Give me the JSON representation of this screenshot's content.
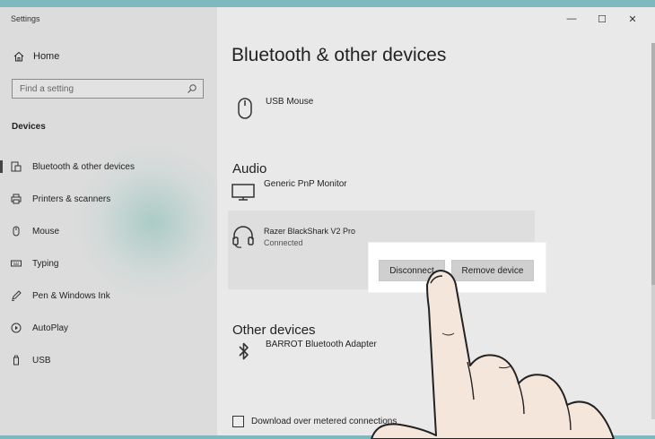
{
  "window": {
    "title": "Settings",
    "controls": {
      "minimize": "—",
      "maximize": "☐",
      "close": "✕"
    }
  },
  "sidebar": {
    "home_label": "Home",
    "search_placeholder": "Find a setting",
    "section_label": "Devices",
    "items": [
      {
        "label": "Bluetooth & other devices",
        "icon": "bluetooth-devices-icon",
        "active": true
      },
      {
        "label": "Printers & scanners",
        "icon": "printer-icon",
        "active": false
      },
      {
        "label": "Mouse",
        "icon": "mouse-icon",
        "active": false
      },
      {
        "label": "Typing",
        "icon": "keyboard-icon",
        "active": false
      },
      {
        "label": "Pen & Windows Ink",
        "icon": "pen-icon",
        "active": false
      },
      {
        "label": "AutoPlay",
        "icon": "autoplay-icon",
        "active": false
      },
      {
        "label": "USB",
        "icon": "usb-icon",
        "active": false
      }
    ]
  },
  "main": {
    "title": "Bluetooth & other devices",
    "mouse_device": {
      "name": "USB Mouse",
      "icon": "mouse-icon"
    },
    "audio": {
      "heading": "Audio",
      "monitor": {
        "name": "Generic PnP Monitor",
        "icon": "monitor-icon"
      },
      "headset": {
        "name": "Razer BlackShark V2 Pro",
        "status": "Connected",
        "icon": "headset-icon"
      }
    },
    "buttons": {
      "disconnect": "Disconnect",
      "remove": "Remove device"
    },
    "other_devices": {
      "heading": "Other devices",
      "bluetooth_adapter": {
        "name": "BARROT Bluetooth Adapter",
        "icon": "bluetooth-icon"
      }
    },
    "metered": {
      "label": "Download over metered connections",
      "checked": false
    }
  },
  "colors": {
    "sidebar_bg": "#dcdcdc",
    "main_bg": "#e9e9e9",
    "callout_bg": "#ffffff",
    "hand_skin": "#f5e6dc"
  }
}
